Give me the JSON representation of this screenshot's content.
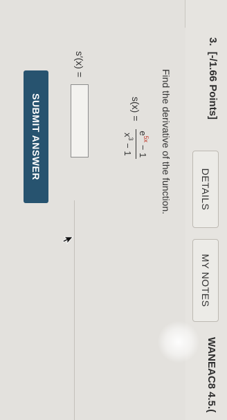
{
  "header": {
    "question_number": "3.",
    "question_points": "[-/1.66 Points]",
    "details_label": "DETAILS",
    "my_notes_label": "MY NOTES",
    "assignment_code": "WANEAC8 4.5.("
  },
  "question": {
    "prompt": "Find the derivative of the function.",
    "function_name": "s(x) =",
    "numerator_base": "e",
    "numerator_exponent": "5x",
    "numerator_rest": " − 1",
    "denominator_base": "x",
    "denominator_exponent": "3",
    "denominator_rest": " − 1",
    "answer_label": "s′(x) =",
    "answer_value": ""
  },
  "actions": {
    "submit_label": "SUBMIT ANSWER"
  },
  "colors": {
    "submit_bg": "#27536f",
    "exponent_red": "#c0392b"
  },
  "icons": {
    "cursor": "mouse-pointer-icon"
  }
}
